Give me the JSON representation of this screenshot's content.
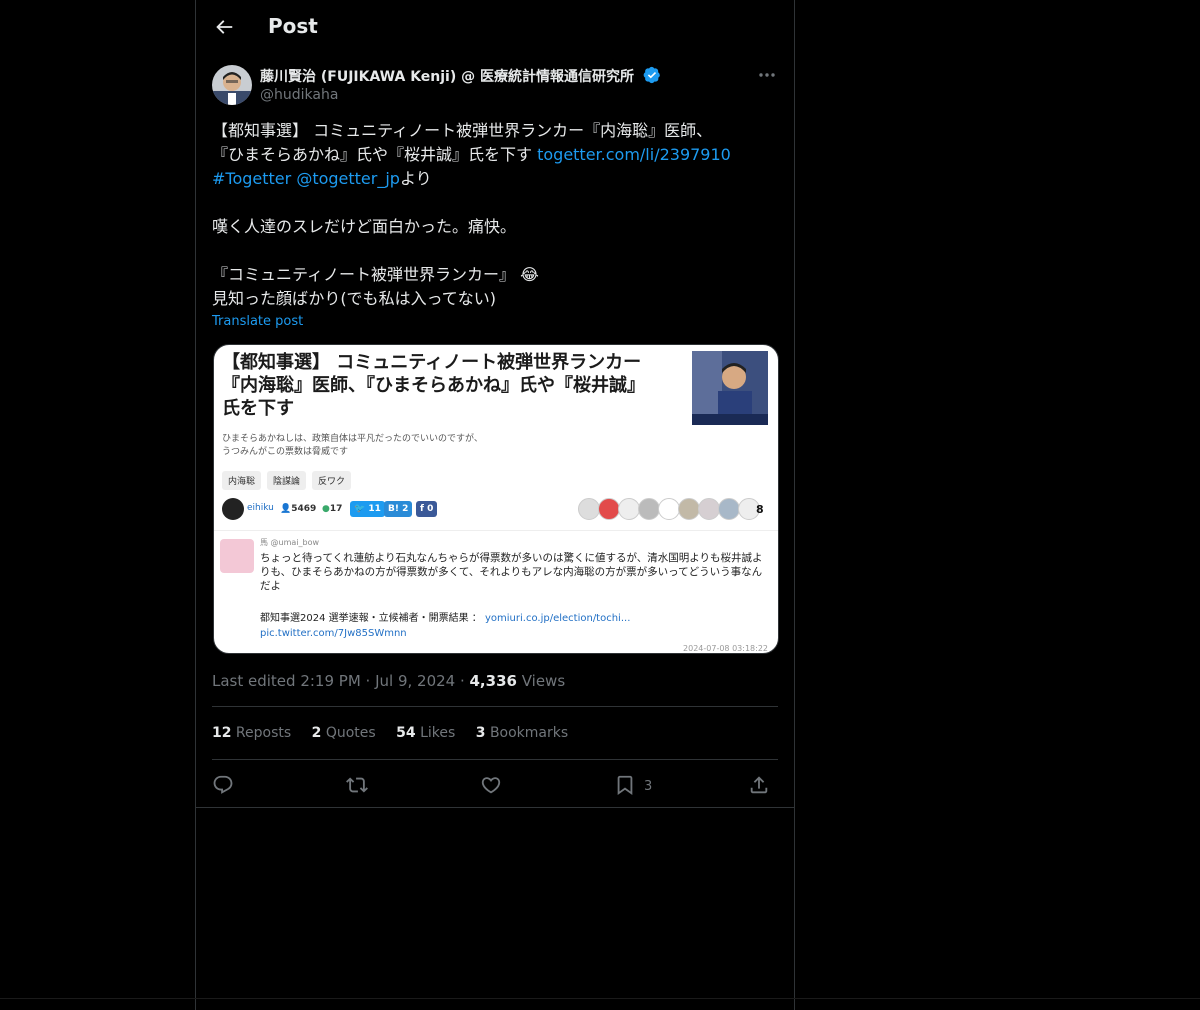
{
  "header": {
    "title": "Post",
    "back_icon": "arrow-left-icon"
  },
  "author": {
    "name": "藤川賢治 (FUJIKAWA Kenji) @ 医療統計情報通信研究所",
    "handle": "@hudikaha",
    "verified_color": "#1d9bf0"
  },
  "post": {
    "line1": "【都知事選】 コミュニティノート被弾世界ランカー『内海聡』医師、",
    "line2_text": "『ひまそらあかね』氏や『桜井誠』氏を下す ",
    "line2_link": "togetter.com/li/2397910",
    "line3_hashtag": "#Togetter",
    "line3_mention": "@togetter_jp",
    "line3_suffix": "より",
    "line4": "嘆く人達のスレだけど面白かった。痛快。",
    "line5": "『コミュニティノート被弾世界ランカー』",
    "line5_emoji": "😂",
    "line6": "見知った顔ばかり(でも私は入ってない)",
    "translate": "Translate post"
  },
  "card": {
    "title_line1": "【都知事選】 コミュニティノート被弾世界ランカー",
    "title_line2": "『内海聡』医師、『ひまそらあかね』氏や『桜井誠』",
    "title_line3": "氏を下す",
    "desc_line1": "ひまそらあかねしは、政策自体は平凡だったのでいいのですが、",
    "desc_line2": "うつみんがこの票数は脅威です",
    "tags": [
      "内海聡",
      "陰謀論",
      "反ワク"
    ],
    "meta_user": "eihiku",
    "meta_followers": "5469",
    "meta_comments": "17",
    "tw_count": "11",
    "hatena_count": "2",
    "fb_count": "0",
    "faces_count": "8",
    "quote_user": "馬 @umai_bow",
    "quote_text": "ちょっと待ってくれ蓮舫より石丸なんちゃらが得票数が多いのは驚くに値するが、清水国明よりも桜井誠よりも、ひまそらあかねの方が得票数が多くて、それよりもアレな内海聡の方が票が多いってどういう事なんだよ",
    "quote_src_line1": "都知事選2024 選挙速報・立候補者・開票結果 ：",
    "quote_src_link": "yomiuri.co.jp/election/tochi...",
    "quote_src_line2": "pic.twitter.com/7Jw85SWmnn",
    "quote_date": "2024-07-08 03:18:22"
  },
  "meta": {
    "edited": "Last edited 2:19 PM · Jul 9, 2024 · ",
    "views_num": "4,336",
    "views_label": " Views"
  },
  "stats": {
    "reposts_num": "12",
    "reposts_label": " Reposts",
    "quotes_num": "2",
    "quotes_label": " Quotes",
    "likes_num": "54",
    "likes_label": " Likes",
    "bookmarks_num": "3",
    "bookmarks_label": " Bookmarks"
  },
  "actions": {
    "reply_icon": "reply-icon",
    "repost_icon": "repost-icon",
    "like_icon": "heart-icon",
    "bookmark_icon": "bookmark-icon",
    "bookmark_count": "3",
    "share_icon": "share-icon"
  }
}
